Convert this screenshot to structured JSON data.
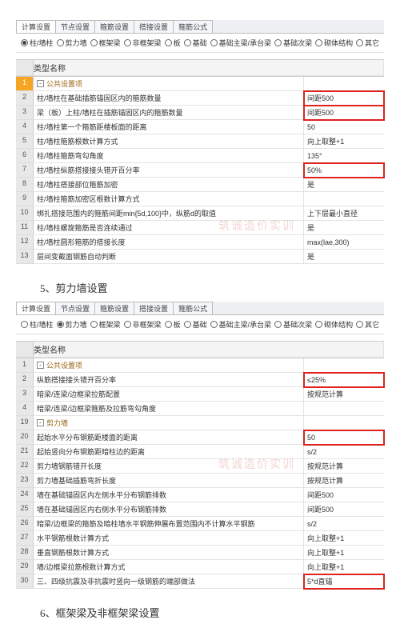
{
  "tabs": [
    "计算设置",
    "节点设置",
    "箍筋设置",
    "搭接设置",
    "箍筋公式"
  ],
  "filters": [
    {
      "label": "柱/墙柱",
      "sel": 0
    },
    {
      "label": "剪力墙",
      "sel": 1
    },
    {
      "label": "框架梁",
      "sel": null
    },
    {
      "label": "非框架梁",
      "sel": null
    },
    {
      "label": "板",
      "sel": null
    },
    {
      "label": "基础",
      "sel": null
    },
    {
      "label": "基础主梁/承台梁",
      "sel": null
    },
    {
      "label": "基础次梁",
      "sel": null
    },
    {
      "label": "砌体结构",
      "sel": null
    },
    {
      "label": "其它",
      "sel": null
    }
  ],
  "col_header": "类型名称",
  "group1": {
    "label": "公共设置项"
  },
  "rows1": [
    {
      "n": "2",
      "name": "柱/墙柱在基础插筋锚固区内的箍筋数量",
      "value": "间距500",
      "hl": true
    },
    {
      "n": "3",
      "name": "梁（板）上柱/墙柱在插筋锚固区内的箍筋数量",
      "value": "间距500",
      "hl": true
    },
    {
      "n": "4",
      "name": "柱/墙柱第一个箍筋距楼板面的距离",
      "value": "50"
    },
    {
      "n": "5",
      "name": "柱/墙柱箍筋根数计算方式",
      "value": "向上取整+1"
    },
    {
      "n": "6",
      "name": "柱/墙柱箍筋弯勾角度",
      "value": "135°"
    },
    {
      "n": "7",
      "name": "柱/墙柱纵筋搭接接头错开百分率",
      "value": "50%",
      "hl": true
    },
    {
      "n": "8",
      "name": "柱/墙柱搭接部位箍筋加密",
      "value": "是"
    },
    {
      "n": "9",
      "name": "柱/墙柱箍筋加密区根数计算方式",
      "value": ""
    },
    {
      "n": "10",
      "name": "绑扎搭接范围内的箍筋间距min{5d,100}中，纵筋d的取值",
      "value": "上下层最小直径"
    },
    {
      "n": "11",
      "name": "柱/墙柱螺旋箍筋是否连续通过",
      "value": "是",
      "wm": "筑诚造价实训"
    },
    {
      "n": "12",
      "name": "柱/墙柱圆形箍筋的搭接长度",
      "value": "max(lae,300)"
    },
    {
      "n": "13",
      "name": "层间变截面钢筋自动判断",
      "value": "是"
    }
  ],
  "section5": "5、剪力墙设置",
  "group2a": {
    "label": "公共设置项"
  },
  "rows2a": [
    {
      "n": "2",
      "name": "纵筋搭接接头错开百分率",
      "value": "≤25%",
      "hl": true
    },
    {
      "n": "3",
      "name": "暗梁/连梁/边框梁拉筋配置",
      "value": "按规范计算"
    },
    {
      "n": "4",
      "name": "暗梁/连梁/边框梁箍筋及拉筋弯勾角度",
      "value": ""
    }
  ],
  "group2b": {
    "n": "19",
    "label": "剪力墙"
  },
  "rows2b": [
    {
      "n": "20",
      "name": "起始水平分布钢筋距楼面的距离",
      "value": "50",
      "hl": true
    },
    {
      "n": "21",
      "name": "起始竖向分布钢筋距暗柱边的距离",
      "value": "s/2"
    },
    {
      "n": "22",
      "name": "剪力墙钢筋错开长度",
      "value": "按规范计算",
      "wm": "筑诚造价实训"
    },
    {
      "n": "23",
      "name": "剪力墙基础插筋弯折长度",
      "value": "按规范计算"
    },
    {
      "n": "24",
      "name": "墙在基础锚固区内左侧水平分布钢筋排数",
      "value": "间距500"
    },
    {
      "n": "25",
      "name": "墙在基础锚固区内右侧水平分布钢筋排数",
      "value": "间距500"
    },
    {
      "n": "26",
      "name": "暗梁/边框梁的箍筋及暗柱墙水平钢筋伸展布置范围内不计算水平钢筋",
      "value": "s/2"
    },
    {
      "n": "27",
      "name": "水平钢筋根数计算方式",
      "value": "向上取整+1"
    },
    {
      "n": "28",
      "name": "垂直钢筋根数计算方式",
      "value": "向上取整+1"
    },
    {
      "n": "29",
      "name": "墙/边框梁拉筋根数计算方式",
      "value": "向上取整+1"
    },
    {
      "n": "30",
      "name": "三、四级抗震及非抗震时竖向一级钢筋的端部做法",
      "value": "5*d直锚",
      "hl": true
    }
  ],
  "section6": "6、框架梁及非框架梁设置"
}
